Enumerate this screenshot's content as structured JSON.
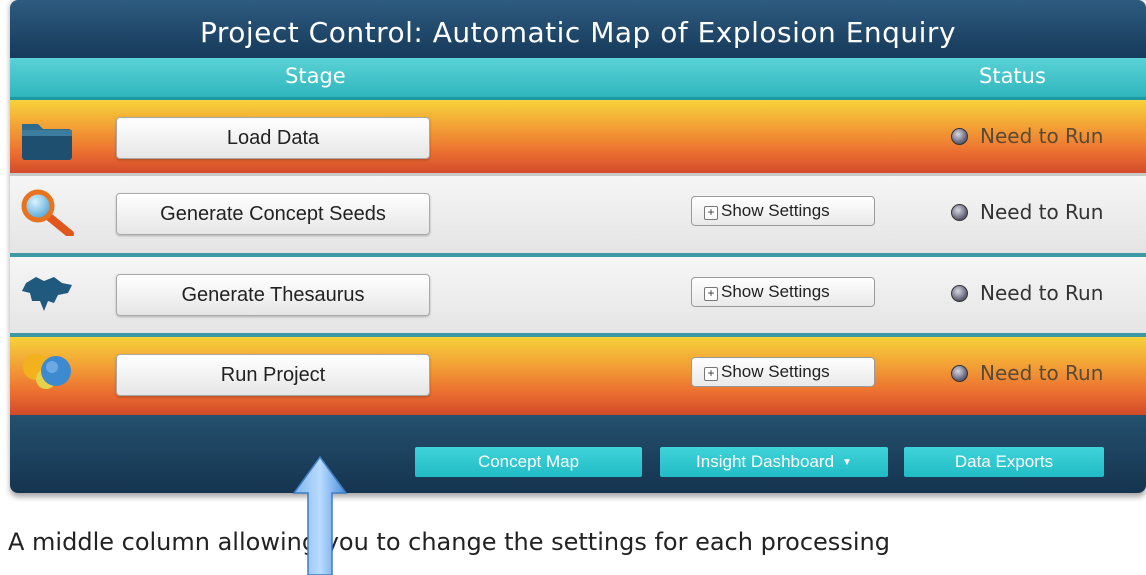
{
  "title": "Project Control: Automatic Map of Explosion Enquiry",
  "columns": {
    "stage": "Stage",
    "status": "Status"
  },
  "stages": [
    {
      "label": "Load Data",
      "status": "Need to Run",
      "icon": "folder-icon",
      "highlight": true
    },
    {
      "label": "Generate Concept Seeds",
      "settings_label": "Show Settings",
      "status": "Need to Run",
      "icon": "magnifier-icon",
      "highlight": false
    },
    {
      "label": "Generate Thesaurus",
      "settings_label": "Show Settings",
      "status": "Need to Run",
      "icon": "map-shape-icon",
      "highlight": false
    },
    {
      "label": "Run Project",
      "settings_label": "Show Settings",
      "status": "Need to Run",
      "icon": "spheres-icon",
      "highlight": true
    }
  ],
  "footer": {
    "concept_map": "Concept Map",
    "insight_dashboard": "Insight Dashboard",
    "data_exports": "Data Exports"
  },
  "caption": "A middle column allowing you to change the settings for each processing",
  "colors": {
    "title_bar": "#1f4a6c",
    "header_bar": "#3ec4ca",
    "highlight_row": "#ef8a33",
    "footer_button": "#2cc6cf"
  }
}
